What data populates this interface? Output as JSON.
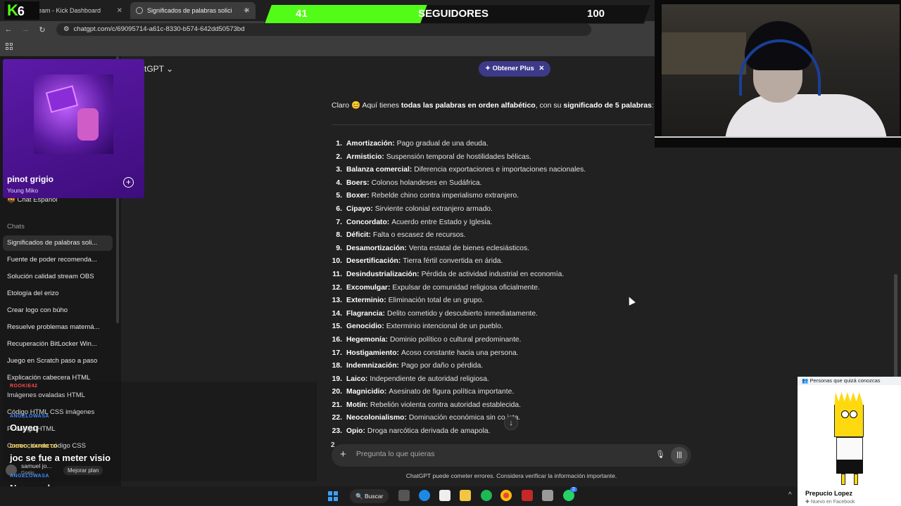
{
  "browser": {
    "tabs": [
      {
        "label": "eam - Kick Dashboard"
      },
      {
        "label": "Significados de palabras solicita"
      }
    ],
    "url": "chatgpt.com/c/69095714-a61c-8330-b574-642dd50573bd"
  },
  "kick_overlay": {
    "logo": "K",
    "logo_num": "6",
    "follower_current": "41",
    "follower_label": "SEGUIDORES",
    "follower_goal": "100",
    "progress": 0.41,
    "accent_color": "#53fc18"
  },
  "spotify": {
    "song": "pinot grigio",
    "artist": "Young Miko"
  },
  "sidebar": {
    "hidden_item": "Chat Español",
    "section_label": "Chats",
    "items": [
      {
        "label": "Significados de palabras soli..."
      },
      {
        "label": "Fuente de poder recomenda..."
      },
      {
        "label": "Solución calidad stream OBS"
      },
      {
        "label": "Etología del erizo"
      },
      {
        "label": "Crear logo con búho"
      },
      {
        "label": "Resuelve problemas matemá..."
      },
      {
        "label": "Recuperación BitLocker Win..."
      },
      {
        "label": "Juego en Scratch paso a paso"
      },
      {
        "label": "Explicación cabecera HTML"
      },
      {
        "label": "Imágenes ovaladas HTML"
      },
      {
        "label": "Código HTML CSS imágenes"
      },
      {
        "label": "Pr código HTML"
      },
      {
        "label": "Corrección de código CSS"
      }
    ],
    "user_name": "samuel jo...",
    "user_plan": "Gratis",
    "upgrade_label": "Mejorar plan"
  },
  "chatgpt": {
    "model_title": "tGPT",
    "plus_button": "Obtener Plus",
    "intro_pre": "Claro",
    "intro_emoji": "😊",
    "intro_mid1": "Aquí tienes",
    "intro_bold1": "todas las palabras en orden alfabético",
    "intro_mid2": ", con su",
    "intro_bold2": "significado de 5 palabras",
    "intro_end": ":",
    "terms": [
      {
        "n": "1.",
        "word": "Amortización:",
        "def": "Pago gradual de una deuda."
      },
      {
        "n": "2.",
        "word": "Armisticio:",
        "def": "Suspensión temporal de hostilidades bélicas."
      },
      {
        "n": "3.",
        "word": "Balanza comercial:",
        "def": "Diferencia exportaciones e importaciones nacionales."
      },
      {
        "n": "4.",
        "word": "Boers:",
        "def": "Colonos holandeses en Sudáfrica."
      },
      {
        "n": "5.",
        "word": "Boxer:",
        "def": "Rebelde chino contra imperialismo extranjero."
      },
      {
        "n": "6.",
        "word": "Cipayo:",
        "def": "Sirviente colonial extranjero armado."
      },
      {
        "n": "7.",
        "word": "Concordato:",
        "def": "Acuerdo entre Estado y Iglesia."
      },
      {
        "n": "8.",
        "word": "Déficit:",
        "def": "Falta o escasez de recursos."
      },
      {
        "n": "9.",
        "word": "Desamortización:",
        "def": "Venta estatal de bienes eclesiásticos."
      },
      {
        "n": "10.",
        "word": "Desertificación:",
        "def": "Tierra fértil convertida en árida."
      },
      {
        "n": "11.",
        "word": "Desindustrialización:",
        "def": "Pérdida de actividad industrial en economía."
      },
      {
        "n": "12.",
        "word": "Excomulgar:",
        "def": "Expulsar de comunidad religiosa oficialmente."
      },
      {
        "n": "13.",
        "word": "Exterminio:",
        "def": "Eliminación total de un grupo."
      },
      {
        "n": "14.",
        "word": "Flagrancia:",
        "def": "Delito cometido y descubierto inmediatamente."
      },
      {
        "n": "15.",
        "word": "Genocidio:",
        "def": "Exterminio intencional de un pueblo."
      },
      {
        "n": "16.",
        "word": "Hegemonía:",
        "def": "Dominio político o cultural predominante."
      },
      {
        "n": "17.",
        "word": "Hostigamiento:",
        "def": "Acoso constante hacia una persona."
      },
      {
        "n": "18.",
        "word": "Indemnización:",
        "def": "Pago por daño o pérdida."
      },
      {
        "n": "19.",
        "word": "Laico:",
        "def": "Independiente de autoridad religiosa."
      },
      {
        "n": "20.",
        "word": "Magnicidio:",
        "def": "Asesinato de figura política importante."
      },
      {
        "n": "21.",
        "word": "Motín:",
        "def": "Rebelión violenta contra autoridad establecida."
      },
      {
        "n": "22.",
        "word": "Neocolonialismo:",
        "def": "Dominación económica sin co   ista."
      },
      {
        "n": "23.",
        "word": "Opio:",
        "def": "Droga narcótica derivada de amapola."
      }
    ],
    "composer_placeholder": "Pregunta lo que quieras",
    "disclaimer": "ChatGPT puede cometer errores. Considera verificar la información importante."
  },
  "stream_chat": [
    {
      "user": "ROOKIE42",
      "user_color": "#ff4b4b",
      "message": ""
    },
    {
      "user": "ANGELOWASA",
      "user_color": "#3f8cff",
      "message": "Ouyeq"
    },
    {
      "user": "DIEGO_BARRETO",
      "user_color": "#ffd23f",
      "message": "joc se fue a meter visio"
    },
    {
      "user": "ANGELOWASA",
      "user_color": "#3f8cff",
      "message": "No se vale"
    }
  ],
  "facebook": {
    "header": "Personas que quizá conozcas",
    "name": "Prepucio Lopez",
    "subtitle": "Nuevo en Facebook"
  },
  "taskbar": {
    "search_label": "Buscar",
    "whatsapp_badge": "2"
  }
}
